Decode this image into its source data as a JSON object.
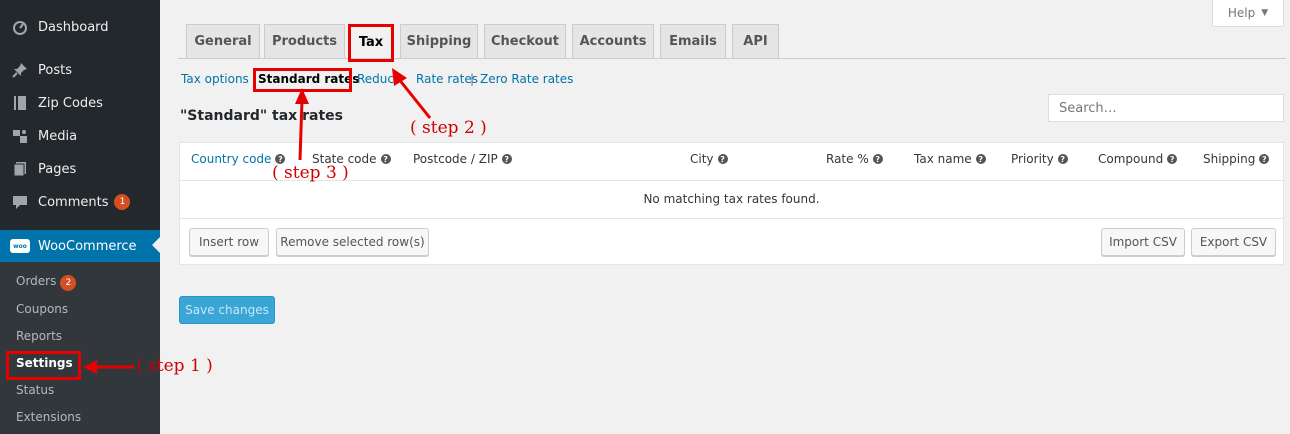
{
  "sidebar": {
    "items": [
      {
        "label": "Dashboard",
        "icon": "dashboard-icon"
      },
      {
        "label": "Posts",
        "icon": "pin-icon"
      },
      {
        "label": "Zip Codes",
        "icon": "book-icon"
      },
      {
        "label": "Media",
        "icon": "media-icon"
      },
      {
        "label": "Pages",
        "icon": "pages-icon"
      },
      {
        "label": "Comments",
        "icon": "comment-icon",
        "badge": "1"
      },
      {
        "label": "WooCommerce",
        "icon": "woo-icon",
        "logo_text": "woo"
      }
    ],
    "submenu": [
      {
        "label": "Orders",
        "badge": "2"
      },
      {
        "label": "Coupons"
      },
      {
        "label": "Reports"
      },
      {
        "label": "Settings",
        "active": true
      },
      {
        "label": "Status"
      },
      {
        "label": "Extensions"
      }
    ]
  },
  "help": {
    "label": "Help",
    "icon": "caret-down-icon"
  },
  "tabs": [
    "General",
    "Products",
    "Tax",
    "Shipping",
    "Checkout",
    "Accounts",
    "Emails",
    "API"
  ],
  "active_tab": "Tax",
  "subsubsub": {
    "tax_options": "Tax options",
    "standard_rates": "Standard rates",
    "reduced": "Reduc",
    "rate_rates": "Rate rates",
    "separator": "|",
    "zero_rate": "Zero Rate rates"
  },
  "page_title": "\"Standard\" tax rates",
  "search": {
    "placeholder": "Search…"
  },
  "table": {
    "columns": [
      "Country code",
      "State code",
      "Postcode / ZIP",
      "City",
      "Rate %",
      "Tax name",
      "Priority",
      "Compound",
      "Shipping"
    ],
    "help_glyph": "?",
    "empty_message": "No matching tax rates found."
  },
  "buttons": {
    "insert_row": "Insert row",
    "remove_selected": "Remove selected row(s)",
    "import_csv": "Import CSV",
    "export_csv": "Export CSV",
    "save_changes": "Save changes"
  },
  "annotations": {
    "step1": "( step 1 )",
    "step2": "( step 2 )",
    "step3": "( step 3 )",
    "color": "#e60000"
  },
  "colors": {
    "sidebar_bg": "#23282d",
    "accent": "#0073aa",
    "badge": "#d54e21",
    "save_button": "#3aa6d6"
  }
}
